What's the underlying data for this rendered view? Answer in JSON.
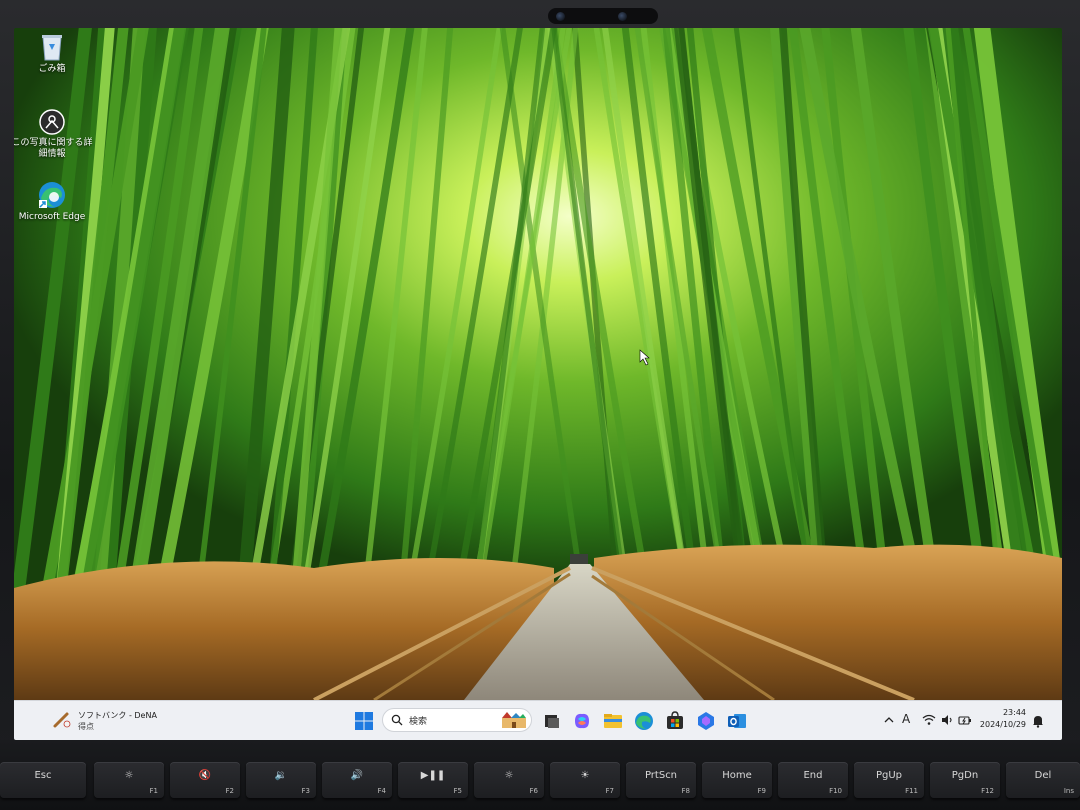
{
  "desktop": {
    "icons": [
      {
        "label": "ごみ箱",
        "icon": "recycle-bin-icon"
      },
      {
        "label": "この写真に関する詳細情報",
        "icon": "learn-about-picture-icon"
      },
      {
        "label": "Microsoft Edge",
        "icon": "edge-icon"
      }
    ]
  },
  "taskbar": {
    "weather": {
      "line1": "ソフトバンク - DeNA",
      "line2": "得点",
      "icon": "baseball-icon"
    },
    "search": {
      "placeholder": "検索"
    },
    "apps": [
      "start-icon",
      "task-view-icon",
      "copilot-icon",
      "file-explorer-icon",
      "edge-icon",
      "microsoft-store-icon",
      "copilot-app-icon",
      "outlook-icon"
    ],
    "clock": {
      "time": "23:44",
      "date": "2024/10/29"
    },
    "ime": "A"
  },
  "keyboard": {
    "keys": [
      {
        "main": "Esc",
        "sub": ""
      },
      {
        "main": "☼",
        "sub": "F1"
      },
      {
        "main": "🔇",
        "sub": "F2"
      },
      {
        "main": "🔉",
        "sub": "F3"
      },
      {
        "main": "🔊",
        "sub": "F4"
      },
      {
        "main": "▶❚❚",
        "sub": "F5"
      },
      {
        "main": "☼",
        "sub": "F6"
      },
      {
        "main": "☀",
        "sub": "F7"
      },
      {
        "main": "PrtScn",
        "sub": "F8"
      },
      {
        "main": "Home",
        "sub": "F9"
      },
      {
        "main": "End",
        "sub": "F10"
      },
      {
        "main": "PgUp",
        "sub": "F11"
      },
      {
        "main": "PgDn",
        "sub": "F12"
      },
      {
        "main": "Del",
        "sub": "Ins"
      }
    ]
  },
  "colors": {
    "taskbar_bg": "#eef0f4",
    "bamboo_light": "#c9f05a",
    "bamboo_dark": "#1f5a14",
    "grass": "#b57a2c",
    "path": "#b9b3a1"
  }
}
